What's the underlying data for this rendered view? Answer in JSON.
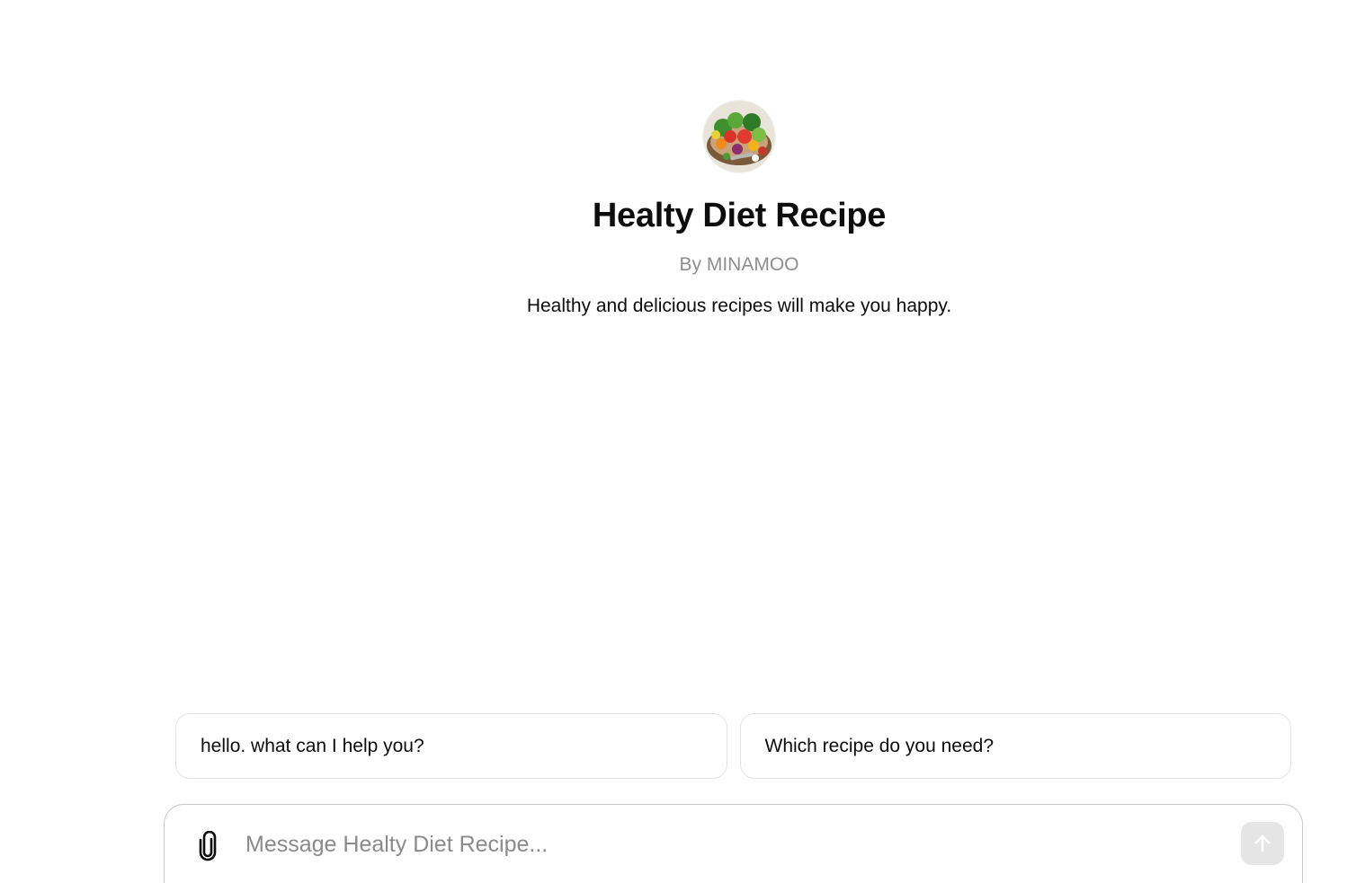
{
  "gpt": {
    "title": "Healty Diet Recipe",
    "author": "By MINAMOO",
    "description": "Healthy and delicious recipes will make you happy.",
    "avatar_icon": "vegetable-bowl-avatar"
  },
  "starters": [
    {
      "label": "hello. what can I help you?"
    },
    {
      "label": "Which recipe do you need?"
    }
  ],
  "composer": {
    "placeholder": "Message Healty Diet Recipe...",
    "value": "",
    "attach_icon": "paperclip-icon",
    "send_icon": "arrow-up-icon"
  },
  "colors": {
    "background": "#ffffff",
    "text": "#0d0d0d",
    "muted": "#8e8e8e",
    "border": "#e3e3e3",
    "send_disabled": "#e5e5e5"
  }
}
